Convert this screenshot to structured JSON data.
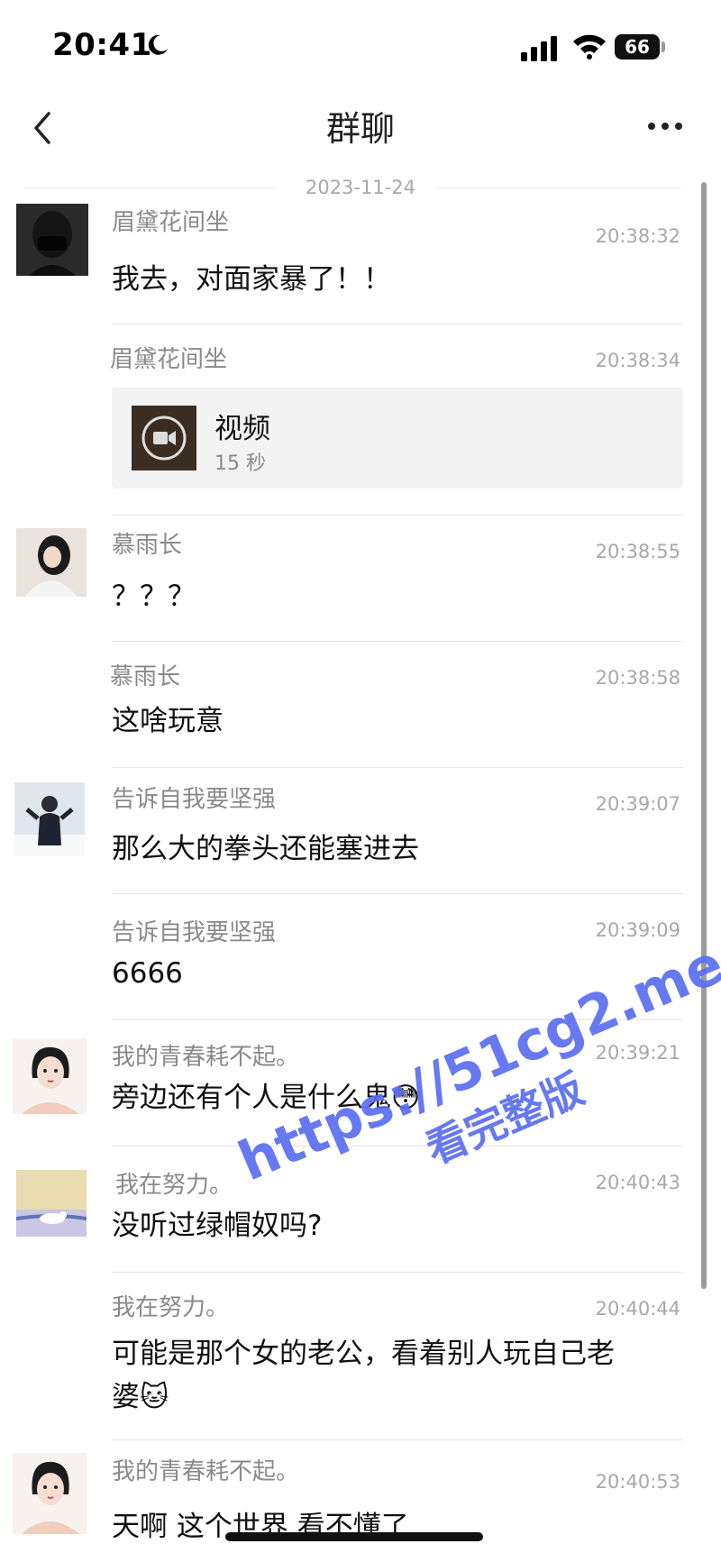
{
  "status_bar": {
    "time": "20:41",
    "battery": "66"
  },
  "nav": {
    "title": "群聊"
  },
  "date_divider": "2023-11-24",
  "messages": [
    {
      "sender": "眉黛花间坐",
      "time": "20:38:32",
      "text": "我去，对面家暴了！！"
    },
    {
      "sender": "眉黛花间坐",
      "time": "20:38:34",
      "video_title": "视频",
      "video_duration": "15 秒"
    },
    {
      "sender": "慕雨长",
      "time": "20:38:55",
      "text": "？？？"
    },
    {
      "sender": "慕雨长",
      "time": "20:38:58",
      "text": "这啥玩意"
    },
    {
      "sender": "告诉自我要坚强",
      "time": "20:39:07",
      "text": "那么大的拳头还能塞进去"
    },
    {
      "sender": "告诉自我要坚强",
      "time": "20:39:09",
      "text": "6666"
    },
    {
      "sender": "我的青春耗不起。",
      "time": "20:39:21",
      "text": "旁边还有个人是什么鬼",
      "emoji": "😳"
    },
    {
      "sender": "我在努力。",
      "time": "20:40:43",
      "text": "没听过绿帽奴吗?"
    },
    {
      "sender": "我在努力。",
      "time": "20:40:44",
      "line1": "可能是那个女的老公，看着别人玩自己老",
      "line2": "婆",
      "emoji": "🐱"
    },
    {
      "sender": "我的青春耗不起。",
      "time": "20:40:53",
      "text": "天啊 这个世界 看不懂了"
    }
  ],
  "watermark": {
    "url": "https://51cg2.me",
    "caption": "看完整版"
  }
}
